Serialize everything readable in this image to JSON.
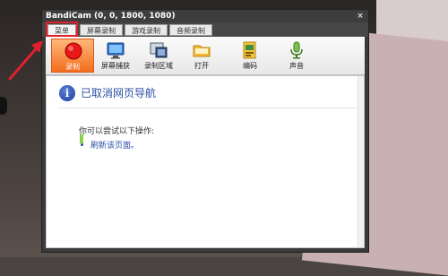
{
  "window": {
    "title": "BandiCam (0, 0, 1800, 1080)",
    "close_glyph": "×"
  },
  "tabs": [
    {
      "label": "菜单",
      "active": true
    },
    {
      "label": "屏幕录制",
      "active": false
    },
    {
      "label": "游戏录制",
      "active": false
    },
    {
      "label": "音频录制",
      "active": false
    }
  ],
  "toolbar": {
    "items": [
      {
        "label": "录制",
        "icon": "record-icon",
        "active": true
      },
      {
        "label": "屏幕捕获",
        "icon": "monitor-icon",
        "active": false
      },
      {
        "label": "录制区域",
        "icon": "region-icon",
        "active": false
      },
      {
        "label": "打开",
        "icon": "folder-icon",
        "active": false
      },
      {
        "label": "编码",
        "icon": "encode-icon",
        "active": false
      },
      {
        "label": "声音",
        "icon": "microphone-icon",
        "active": false
      }
    ]
  },
  "content": {
    "title": "已取消网页导航",
    "tip": "你可以尝试以下操作:",
    "refresh_link": "刷新该页面。",
    "info_glyph": "i"
  },
  "colors": {
    "highlight": "#e0212a",
    "record_active": "#f36d1d",
    "link": "#2b4ea3"
  }
}
